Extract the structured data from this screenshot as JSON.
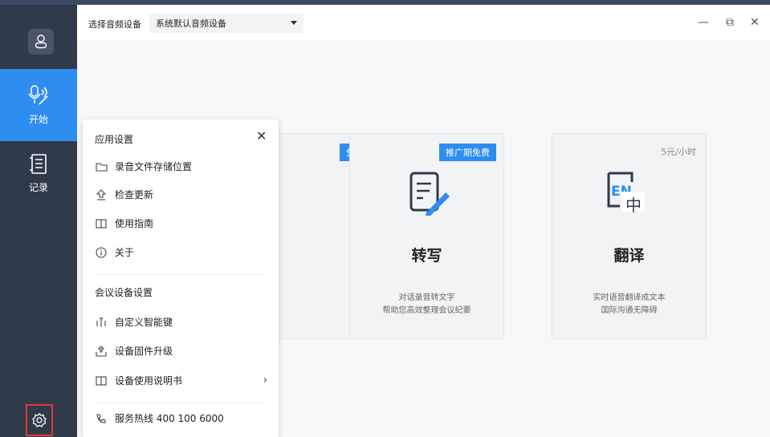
{
  "sidebar": {
    "start_label": "开始",
    "record_label": "记录"
  },
  "titlebar": {
    "device_label": "选择音频设备",
    "device_value": "系统默认音频设备",
    "minimize": "—",
    "restore": "⧉",
    "close": "✕"
  },
  "cards": [
    {
      "tag": "免费"
    },
    {
      "tag": "推广期免费",
      "title": "转写",
      "desc1": "对话录音转文字",
      "desc2": "帮助您高效整理会议纪要"
    },
    {
      "price": "5元/小时",
      "title": "翻译",
      "desc1": "实时语音翻译成文本",
      "desc2": "国际沟通无障碍"
    }
  ],
  "popup": {
    "app_settings": "应用设置",
    "close": "✕",
    "storage": "录音文件存储位置",
    "update": "检查更新",
    "guide": "使用指南",
    "about": "关于",
    "meeting_settings": "会议设备设置",
    "smart_key": "自定义智能键",
    "firmware": "设备固件升级",
    "manual": "设备使用说明书",
    "hotline": "服务热线 400 100 6000"
  },
  "colors": {
    "sidebar": "#2f3a4b",
    "accent": "#2e8df0",
    "highlight_border": "#e53935"
  }
}
